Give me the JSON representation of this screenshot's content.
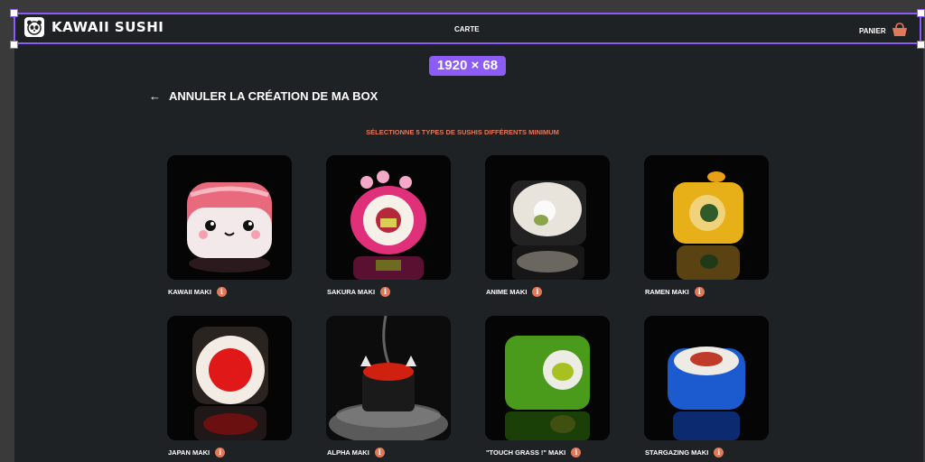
{
  "header": {
    "brand": "KAWAII SUSHI",
    "nav_carte": "CARTE",
    "cart_label": "PANIER"
  },
  "editor": {
    "selection_size": "1920 × 68"
  },
  "page": {
    "back_label": "ANNULER LA CRÉATION DE MA BOX",
    "back_icon": "arrow-left-icon",
    "instruction": "SÉLECTIONNE 5 TYPES DE SUSHIS DIFFÉRENTS MINIMUM"
  },
  "colors": {
    "accent": "#e0785a",
    "selection": "#8b5cf6",
    "background": "#1f2224"
  },
  "products": [
    {
      "name": "KAWAII MAKI",
      "info": "i"
    },
    {
      "name": "SAKURA MAKI",
      "info": "i"
    },
    {
      "name": "ANIME MAKI",
      "info": "i"
    },
    {
      "name": "RAMEN MAKI",
      "info": "i"
    },
    {
      "name": "JAPAN MAKI",
      "info": "i"
    },
    {
      "name": "ALPHA MAKI",
      "info": "i"
    },
    {
      "name": "\"TOUCH GRASS !\" MAKI",
      "info": "i"
    },
    {
      "name": "STARGAZING MAKI",
      "info": "i"
    }
  ]
}
